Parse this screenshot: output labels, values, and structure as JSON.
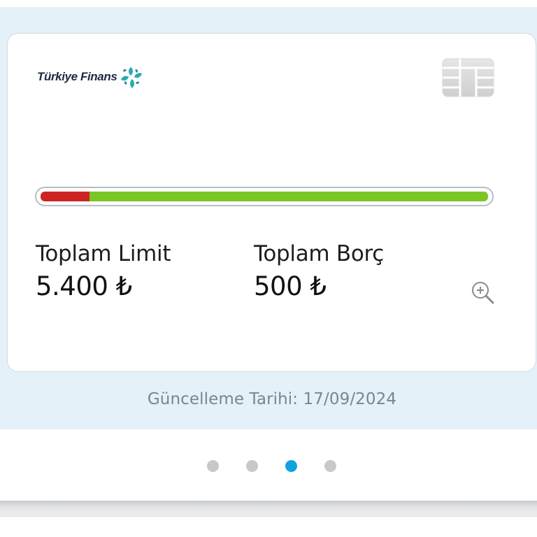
{
  "card": {
    "bank_name": "Türkiye Finans",
    "logo_icon": "turkiye-finans-flower-logo",
    "chip_icon": "card-chip-icon",
    "usage_bar": {
      "used_fraction": 0.11,
      "used_color": "#cf2424",
      "available_color": "#7cc623"
    },
    "total_limit": {
      "label": "Toplam Limit",
      "value": "5.400 ₺"
    },
    "total_debt": {
      "label": "Toplam Borç",
      "value": "500 ₺"
    },
    "zoom_icon": "zoom-in-icon"
  },
  "updated": {
    "text": "Güncelleme Tarihi: 17/09/2024"
  },
  "pager": {
    "count": 4,
    "active_index": 2,
    "active_color": "#0fa4dc",
    "inactive_color": "#c8c8c8"
  },
  "colors": {
    "background": "#e5f1f9",
    "card": "#ffffff"
  }
}
